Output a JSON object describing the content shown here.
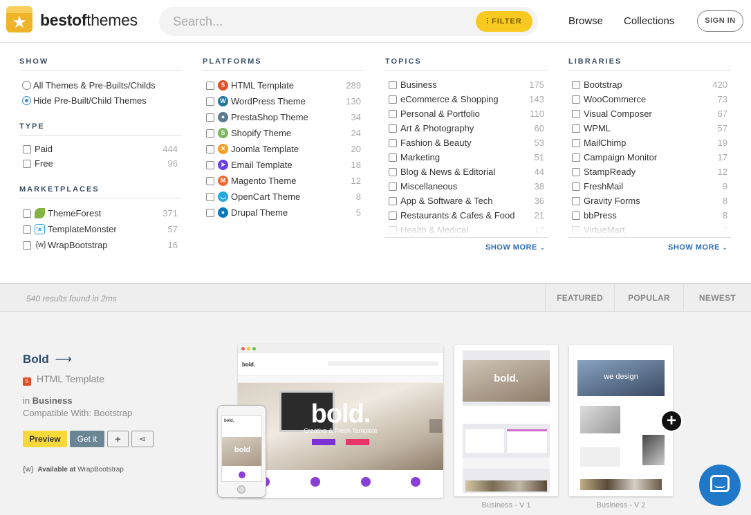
{
  "header": {
    "logo_bold": "bestof",
    "logo_light": "themes",
    "search_placeholder": "Search...",
    "filter_label": "FILTER",
    "nav": [
      "Browse",
      "Collections"
    ],
    "signin": "SIGN IN"
  },
  "show": {
    "title": "SHOW",
    "options": [
      {
        "label": "All Themes & Pre-Builts/Childs",
        "selected": false
      },
      {
        "label": "Hide Pre-Built/Child Themes",
        "selected": true
      }
    ]
  },
  "type": {
    "title": "TYPE",
    "items": [
      {
        "label": "Paid",
        "count": "444"
      },
      {
        "label": "Free",
        "count": "96"
      }
    ]
  },
  "marketplaces": {
    "title": "MARKETPLACES",
    "items": [
      {
        "label": "ThemeForest",
        "count": "371",
        "icon": "leaf-icon"
      },
      {
        "label": "TemplateMonster",
        "count": "57",
        "icon": "monster-icon"
      },
      {
        "label": "WrapBootstrap",
        "count": "16",
        "icon": "braces-icon"
      }
    ]
  },
  "platforms": {
    "title": "PLATFORMS",
    "items": [
      {
        "label": "HTML Template",
        "count": "289",
        "icon": "html5-icon",
        "color": "#e44d26",
        "glyph": "5"
      },
      {
        "label": "WordPress Theme",
        "count": "130",
        "icon": "wordpress-icon",
        "color": "#21759b",
        "glyph": "W"
      },
      {
        "label": "PrestaShop Theme",
        "count": "34",
        "icon": "prestashop-icon",
        "color": "#5a7d91",
        "glyph": "●"
      },
      {
        "label": "Shopify Theme",
        "count": "24",
        "icon": "shopify-icon",
        "color": "#7ab55c",
        "glyph": "S"
      },
      {
        "label": "Joomla Template",
        "count": "20",
        "icon": "joomla-icon",
        "color": "#f4a023",
        "glyph": "✕"
      },
      {
        "label": "Email Template",
        "count": "18",
        "icon": "email-icon",
        "color": "#6a3de8",
        "glyph": "➤"
      },
      {
        "label": "Magento Theme",
        "count": "12",
        "icon": "magento-icon",
        "color": "#ee672f",
        "glyph": "M"
      },
      {
        "label": "OpenCart Theme",
        "count": "8",
        "icon": "opencart-icon",
        "color": "#23a8e0",
        "glyph": "◡"
      },
      {
        "label": "Drupal Theme",
        "count": "5",
        "icon": "drupal-icon",
        "color": "#0678be",
        "glyph": "●"
      }
    ]
  },
  "topics": {
    "title": "TOPICS",
    "items": [
      {
        "label": "Business",
        "count": "175"
      },
      {
        "label": "eCommerce & Shopping",
        "count": "143"
      },
      {
        "label": "Personal & Portfolio",
        "count": "110"
      },
      {
        "label": "Art & Photography",
        "count": "60"
      },
      {
        "label": "Fashion & Beauty",
        "count": "53"
      },
      {
        "label": "Marketing",
        "count": "51"
      },
      {
        "label": "Blog & News & Editorial",
        "count": "44"
      },
      {
        "label": "Miscellaneous",
        "count": "38"
      },
      {
        "label": "App & Software & Tech",
        "count": "36"
      },
      {
        "label": "Restaurants & Cafes & Food",
        "count": "21"
      },
      {
        "label": "Health & Medical",
        "count": "17"
      }
    ],
    "show_more": "SHOW MORE"
  },
  "libraries": {
    "title": "LIBRARIES",
    "items": [
      {
        "label": "Bootstrap",
        "count": "420"
      },
      {
        "label": "WooCommerce",
        "count": "73"
      },
      {
        "label": "Visual Composer",
        "count": "67"
      },
      {
        "label": "WPML",
        "count": "57"
      },
      {
        "label": "MailChimp",
        "count": "19"
      },
      {
        "label": "Campaign Monitor",
        "count": "17"
      },
      {
        "label": "StampReady",
        "count": "12"
      },
      {
        "label": "FreshMail",
        "count": "9"
      },
      {
        "label": "Gravity Forms",
        "count": "8"
      },
      {
        "label": "bbPress",
        "count": "8"
      },
      {
        "label": "VirtueMart",
        "count": "7"
      }
    ],
    "show_more": "SHOW MORE"
  },
  "results_bar": {
    "results": "540 results found in 2ms",
    "sorts": [
      "FEATURED",
      "POPULAR",
      "NEWEST"
    ]
  },
  "theme": {
    "title": "Bold",
    "type": "HTML Template",
    "category_prefix": "in",
    "category": "Business",
    "compatible": "Compatible With: Bootstrap",
    "preview": "Preview",
    "getit": "Get it",
    "available_prefix": "Available at",
    "available_site": "WrapBootstrap",
    "hero_text": "bold.",
    "hero_sub": "Creative & Fresh Template",
    "variant_hero_1": "bold.",
    "variant_hero_2": "we design",
    "captions": [
      "Business - V 1",
      "Business - V 2"
    ]
  }
}
